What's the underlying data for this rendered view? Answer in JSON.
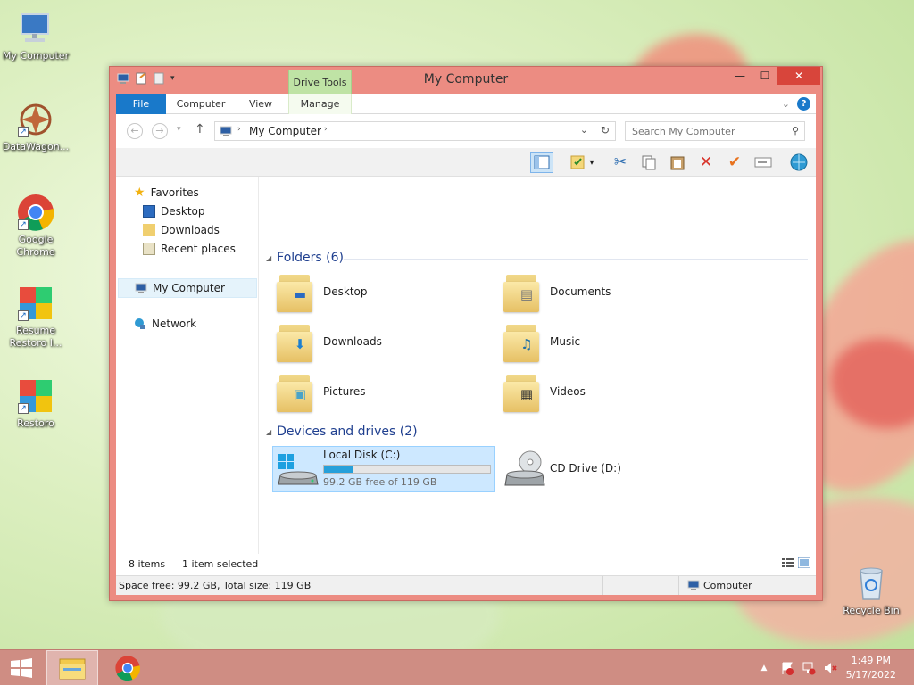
{
  "desktop": {
    "icons": [
      {
        "label": "My Computer"
      },
      {
        "label": "DataWagon..."
      },
      {
        "label": "Google Chrome"
      },
      {
        "label": "Resume Restoro I..."
      },
      {
        "label": "Restoro"
      },
      {
        "label": "Recycle Bin"
      }
    ]
  },
  "window": {
    "title": "My Computer",
    "context_tab": "Drive Tools",
    "close_glyph": "✕",
    "min_glyph": "—",
    "max_glyph": "☐"
  },
  "ribbon": {
    "tabs": [
      "File",
      "Computer",
      "View",
      "Manage"
    ],
    "help": "?"
  },
  "navbar": {
    "address": "My Computer",
    "search_placeholder": "Search My Computer"
  },
  "navpane": {
    "favorites": "Favorites",
    "desktop": "Desktop",
    "downloads": "Downloads",
    "recent": "Recent places",
    "computer": "My Computer",
    "network": "Network"
  },
  "folders": {
    "header": "Folders (6)",
    "items": [
      "Desktop",
      "Documents",
      "Downloads",
      "Music",
      "Pictures",
      "Videos"
    ]
  },
  "devices": {
    "header": "Devices and drives (2)",
    "local_disk": {
      "name": "Local Disk (C:)",
      "free": "99.2 GB free of 119 GB",
      "used_fraction": 0.17
    },
    "cd_drive": {
      "name": "CD Drive (D:)"
    }
  },
  "status": {
    "items": "8 items",
    "selected": "1 item selected",
    "space": "Space free: 99.2 GB, Total size: 119 GB",
    "location": "Computer"
  },
  "taskbar": {
    "time": "1:49 PM",
    "date": "5/17/2022"
  },
  "colors": {
    "window_frame": "#ec8c82",
    "accent": "#1979ca",
    "context_tab": "#bfe3a5"
  }
}
